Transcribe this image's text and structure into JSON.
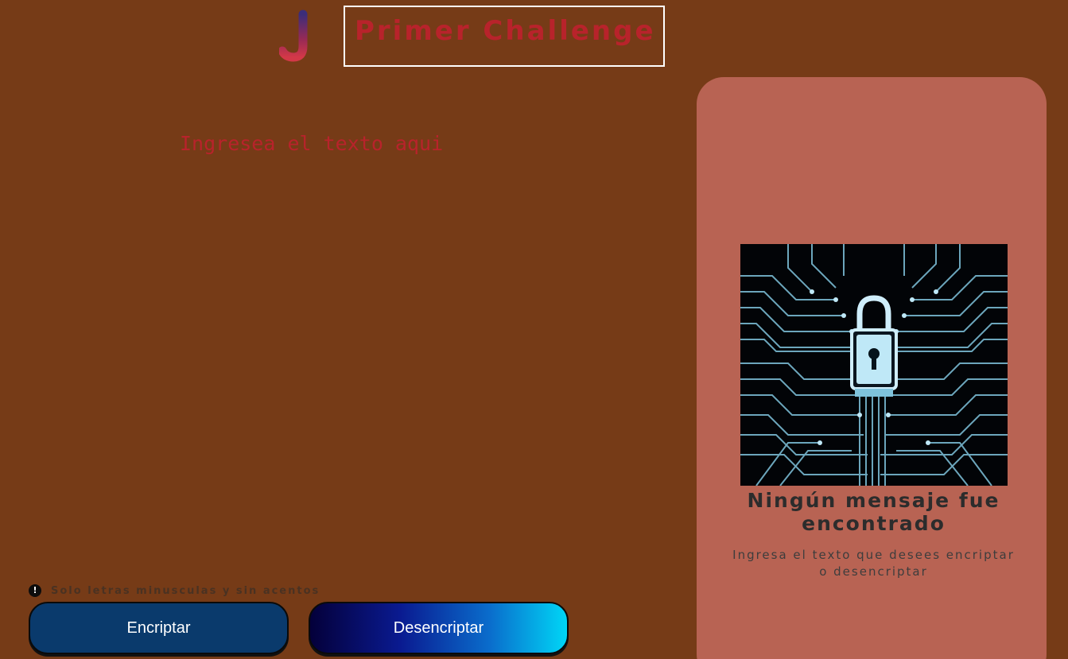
{
  "header": {
    "logo_letter": "J",
    "title": "Primer Challenge"
  },
  "input": {
    "placeholder": "Ingresea el texto aqui",
    "value": ""
  },
  "hint": {
    "icon": "exclamation-circle-icon",
    "text": "Solo letras minusculas y sin acentos"
  },
  "buttons": {
    "encrypt_label": "Encriptar",
    "decrypt_label": "Desencriptar"
  },
  "output": {
    "image_icon": "padlock-circuit-icon",
    "empty_title": "Ningún mensaje fue encontrado",
    "empty_subtitle": "Ingresa el texto que desees encriptar o desencriptar"
  },
  "colors": {
    "background": "#763b17",
    "title_text": "#b8232b",
    "panel": "#b86353",
    "encrypt_button": "#0a3a6c",
    "decrypt_gradient_start": "#04003a",
    "decrypt_gradient_end": "#00d6f6"
  }
}
